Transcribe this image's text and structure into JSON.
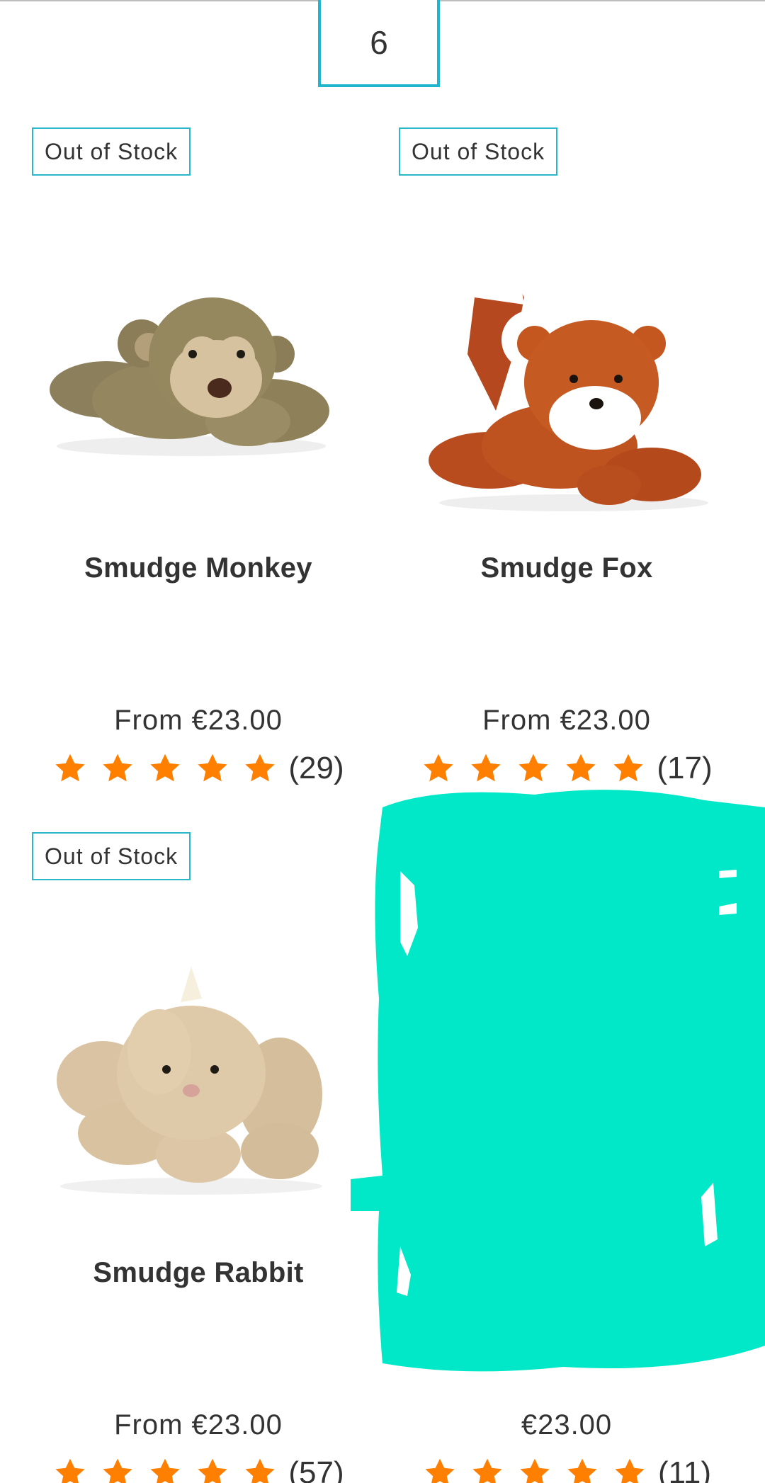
{
  "pagination": {
    "current_page": "6"
  },
  "colors": {
    "accent": "#1eb6cc",
    "star": "#ff7f00",
    "redaction": "#00e8c8"
  },
  "products": [
    {
      "badge": "Out of Stock",
      "image_icon": "monkey-plush-icon",
      "title": "Smudge Monkey",
      "price": "From €23.00",
      "rating": 5,
      "review_count": "(29)"
    },
    {
      "badge": "Out of Stock",
      "image_icon": "fox-plush-icon",
      "title": "Smudge Fox",
      "price": "From €23.00",
      "rating": 5,
      "review_count": "(17)"
    },
    {
      "badge": "Out of Stock",
      "image_icon": "rabbit-plush-icon",
      "title": "Smudge Rabbit",
      "price": "From €23.00",
      "rating": 5,
      "review_count": "(57)"
    },
    {
      "badge": "",
      "image_icon": "redacted",
      "title": "",
      "price": "€23.00",
      "rating": 5,
      "review_count": "(11)"
    }
  ]
}
